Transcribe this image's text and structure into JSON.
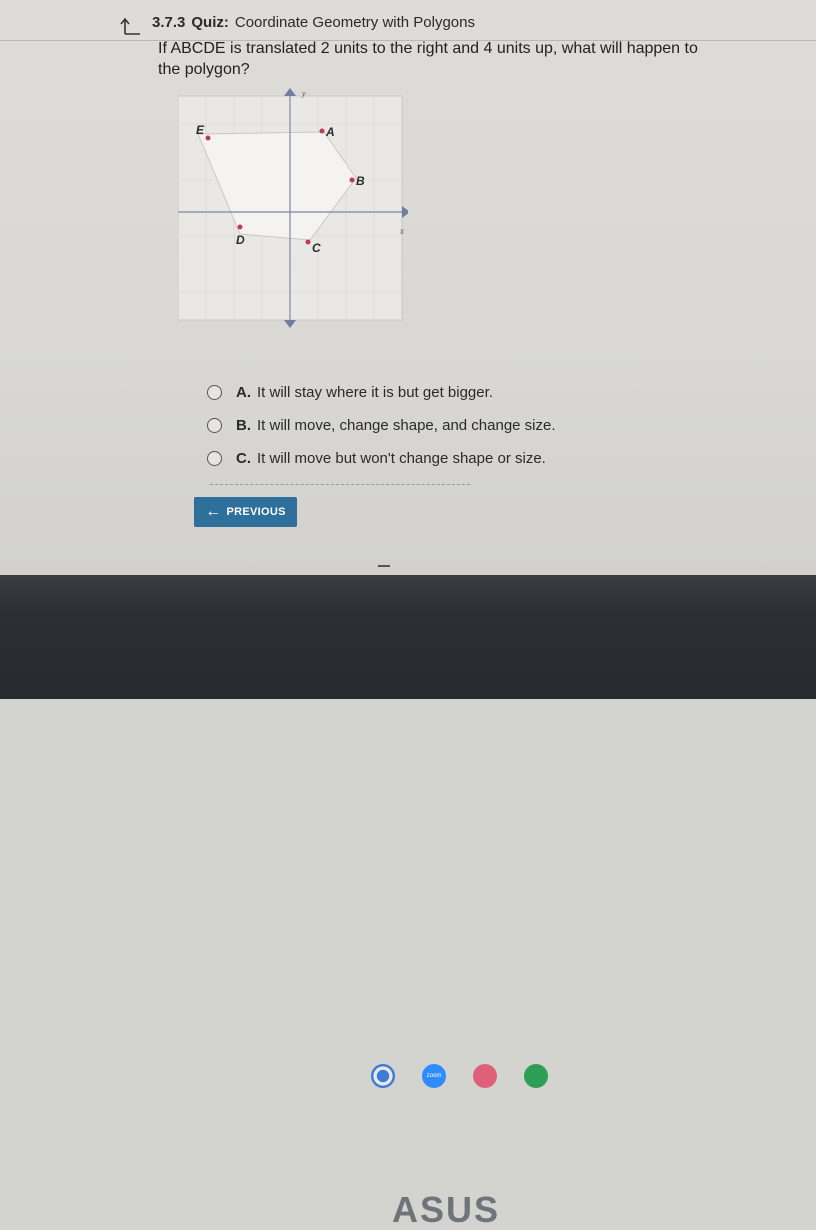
{
  "header": {
    "quiz_number": "3.7.3",
    "quiz_label": "Quiz:",
    "quiz_name": "Coordinate Geometry with Polygons"
  },
  "question": {
    "text": "If ABCDE is translated 2 units to the right and 4 units up, what will happen to the polygon?"
  },
  "graph": {
    "axis_y_label": "y",
    "axis_x_label": "x",
    "points": [
      {
        "label": "A"
      },
      {
        "label": "B"
      },
      {
        "label": "C"
      },
      {
        "label": "D"
      },
      {
        "label": "E"
      }
    ]
  },
  "choices": [
    {
      "letter": "A.",
      "text": "It will stay where it is but get bigger."
    },
    {
      "letter": "B.",
      "text": "It will move, change shape, and change size."
    },
    {
      "letter": "C.",
      "text": "It will move but won't change shape or size."
    }
  ],
  "navigation": {
    "previous_label": "PREVIOUS"
  },
  "shelf": {
    "apps": [
      {
        "name": "chrome-icon",
        "color": "#3d7bd9"
      },
      {
        "name": "zoom-icon",
        "color": "#2d8cff",
        "label": "zoom"
      },
      {
        "name": "app-icon",
        "color": "#e0607a"
      },
      {
        "name": "classroom-icon",
        "color": "#2f9e55"
      }
    ]
  },
  "hardware": {
    "brand": "ASUS"
  }
}
